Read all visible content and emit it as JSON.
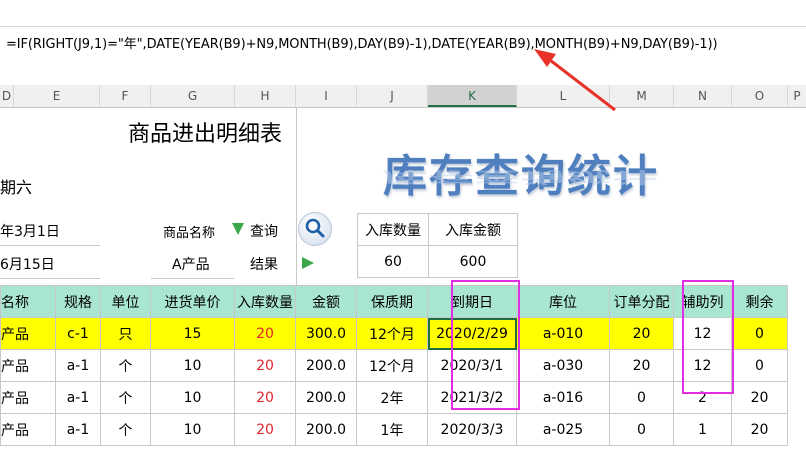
{
  "formula_bar": {
    "formula": "=IF(RIGHT(J9,1)=\"年\",DATE(YEAR(B9)+N9,MONTH(B9),DAY(B9)-1),DATE(YEAR(B9),MONTH(B9)+N9,DAY(B9)-1))"
  },
  "column_headers": [
    "D",
    "E",
    "F",
    "G",
    "H",
    "I",
    "J",
    "K",
    "L",
    "M",
    "N",
    "O",
    "P"
  ],
  "active_column": "K",
  "sheet": {
    "title": "商品进出明细表",
    "big_title": "库存查询统计",
    "weekday_fragment": "期六",
    "start_date_fragment": "年3月1日",
    "end_date_fragment": "6月15日",
    "product_name_label": "商品名称",
    "query_label": "查询",
    "product_value": "A产品",
    "result_label": "结果",
    "summary": {
      "headers": [
        "入库数量",
        "入库金额"
      ],
      "values": [
        "60",
        "600"
      ]
    }
  },
  "table": {
    "headers": [
      "名称",
      "规格",
      "单位",
      "进货单价",
      "入库数量",
      "金额",
      "保质期",
      "到期日",
      "库位",
      "订单分配",
      "辅助列",
      "剩余"
    ],
    "rows": [
      [
        "产品",
        "c-1",
        "只",
        "15",
        "20",
        "300.0",
        "12个月",
        "2020/2/29",
        "a-010",
        "20",
        "12",
        "0"
      ],
      [
        "产品",
        "a-1",
        "个",
        "10",
        "20",
        "200.0",
        "12个月",
        "2020/3/1",
        "a-030",
        "20",
        "12",
        "0"
      ],
      [
        "产品",
        "a-1",
        "个",
        "10",
        "20",
        "200.0",
        "2年",
        "2021/3/2",
        "a-016",
        "0",
        "2",
        "20"
      ],
      [
        "产品",
        "a-1",
        "个",
        "10",
        "20",
        "200.0",
        "1年",
        "2020/3/3",
        "a-025",
        "0",
        "1",
        "20"
      ]
    ]
  },
  "colors": {
    "header_bg": "#a9e6d0",
    "highlight_row": "#ffff00",
    "red_text": "#e2262b",
    "annotation_box": "#e22ee2",
    "arrow": "#e8332a"
  }
}
